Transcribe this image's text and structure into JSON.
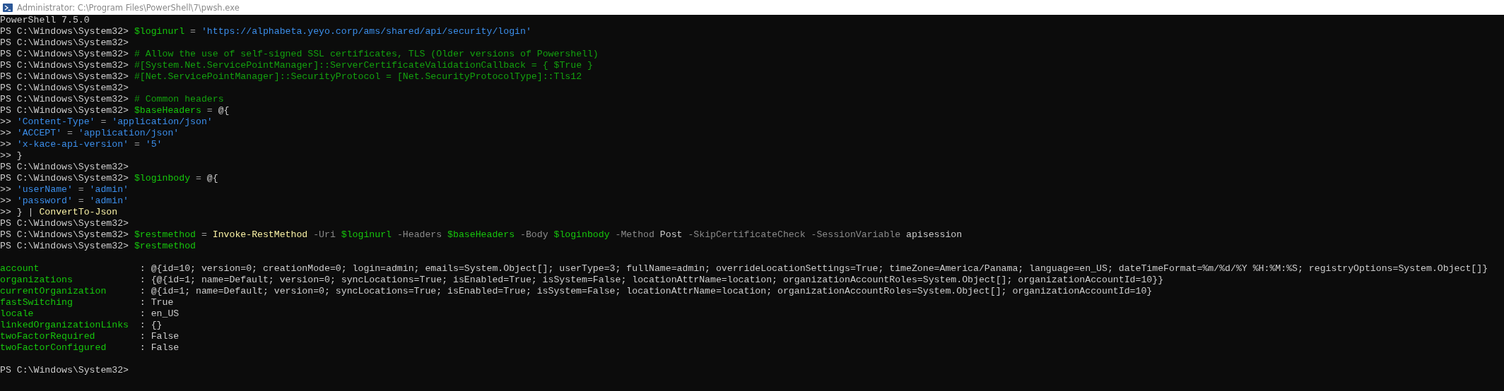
{
  "window": {
    "title": "Administrator: C:\\Program Files\\PowerShell\\7\\pwsh.exe"
  },
  "lines": [
    {
      "kind": "text",
      "segments": [
        {
          "kind": "plain",
          "text": "PowerShell 7.5.0"
        }
      ]
    },
    {
      "kind": "text",
      "segments": [
        {
          "kind": "prompt",
          "text": "PS C:\\Windows\\System32>"
        },
        {
          "kind": "variable",
          "text": "$loginurl"
        },
        {
          "kind": "operator",
          "text": "="
        },
        {
          "kind": "string",
          "text": "'https://alphabeta.yeyo.corp/ams/shared/api/security/login'"
        }
      ]
    },
    {
      "kind": "text",
      "segments": [
        {
          "kind": "prompt",
          "text": "PS C:\\Windows\\System32>"
        }
      ]
    },
    {
      "kind": "text",
      "segments": [
        {
          "kind": "prompt",
          "text": "PS C:\\Windows\\System32>"
        },
        {
          "kind": "comment",
          "text": "# Allow the use of self-signed SSL certificates, TLS (Older versions of Powershell)"
        }
      ]
    },
    {
      "kind": "text",
      "segments": [
        {
          "kind": "prompt",
          "text": "PS C:\\Windows\\System32>"
        },
        {
          "kind": "comment",
          "text": "#[System.Net.ServicePointManager]::ServerCertificateValidationCallback = { $True }"
        }
      ]
    },
    {
      "kind": "text",
      "segments": [
        {
          "kind": "prompt",
          "text": "PS C:\\Windows\\System32>"
        },
        {
          "kind": "comment",
          "text": "#[Net.ServicePointManager]::SecurityProtocol = [Net.SecurityProtocolType]::Tls12"
        }
      ]
    },
    {
      "kind": "text",
      "segments": [
        {
          "kind": "prompt",
          "text": "PS C:\\Windows\\System32>"
        }
      ]
    },
    {
      "kind": "text",
      "segments": [
        {
          "kind": "prompt",
          "text": "PS C:\\Windows\\System32>"
        },
        {
          "kind": "comment",
          "text": "# Common headers"
        }
      ]
    },
    {
      "kind": "text",
      "segments": [
        {
          "kind": "prompt",
          "text": "PS C:\\Windows\\System32>"
        },
        {
          "kind": "variable",
          "text": "$baseHeaders"
        },
        {
          "kind": "operator",
          "text": "="
        },
        {
          "kind": "plain",
          "text": "@{"
        }
      ]
    },
    {
      "kind": "text",
      "segments": [
        {
          "kind": "prompt",
          "text": ">>"
        },
        {
          "kind": "string",
          "text": "'Content-Type'"
        },
        {
          "kind": "operator",
          "text": "="
        },
        {
          "kind": "string",
          "text": "'application/json'"
        }
      ]
    },
    {
      "kind": "text",
      "segments": [
        {
          "kind": "prompt",
          "text": ">>"
        },
        {
          "kind": "string",
          "text": "'ACCEPT'"
        },
        {
          "kind": "operator",
          "text": "="
        },
        {
          "kind": "string",
          "text": "'application/json'"
        }
      ]
    },
    {
      "kind": "text",
      "segments": [
        {
          "kind": "prompt",
          "text": ">>"
        },
        {
          "kind": "string",
          "text": "'x-kace-api-version'"
        },
        {
          "kind": "operator",
          "text": "="
        },
        {
          "kind": "string",
          "text": "'5'"
        }
      ]
    },
    {
      "kind": "text",
      "segments": [
        {
          "kind": "prompt",
          "text": ">>"
        },
        {
          "kind": "plain",
          "text": "}"
        }
      ]
    },
    {
      "kind": "text",
      "segments": [
        {
          "kind": "prompt",
          "text": "PS C:\\Windows\\System32>"
        }
      ]
    },
    {
      "kind": "text",
      "segments": [
        {
          "kind": "prompt",
          "text": "PS C:\\Windows\\System32>"
        },
        {
          "kind": "variable",
          "text": "$loginbody"
        },
        {
          "kind": "operator",
          "text": "="
        },
        {
          "kind": "plain",
          "text": "@{"
        }
      ]
    },
    {
      "kind": "text",
      "segments": [
        {
          "kind": "prompt",
          "text": ">>"
        },
        {
          "kind": "string",
          "text": "'userName'"
        },
        {
          "kind": "operator",
          "text": "="
        },
        {
          "kind": "string",
          "text": "'admin'"
        }
      ]
    },
    {
      "kind": "text",
      "segments": [
        {
          "kind": "prompt",
          "text": ">>"
        },
        {
          "kind": "string",
          "text": "'password'"
        },
        {
          "kind": "operator",
          "text": "="
        },
        {
          "kind": "string",
          "text": "'admin'"
        }
      ]
    },
    {
      "kind": "text",
      "segments": [
        {
          "kind": "prompt",
          "text": ">>"
        },
        {
          "kind": "plain",
          "text": "}"
        },
        {
          "kind": "plain",
          "text": "|"
        },
        {
          "kind": "command",
          "text": "ConvertTo-Json"
        }
      ]
    },
    {
      "kind": "text",
      "segments": [
        {
          "kind": "prompt",
          "text": "PS C:\\Windows\\System32>"
        }
      ]
    },
    {
      "kind": "text",
      "segments": [
        {
          "kind": "prompt",
          "text": "PS C:\\Windows\\System32>"
        },
        {
          "kind": "variable",
          "text": "$restmethod"
        },
        {
          "kind": "operator",
          "text": "="
        },
        {
          "kind": "command",
          "text": "Invoke-RestMethod"
        },
        {
          "kind": "parameter",
          "text": "-Uri"
        },
        {
          "kind": "variable",
          "text": "$loginurl"
        },
        {
          "kind": "parameter",
          "text": "-Headers"
        },
        {
          "kind": "variable",
          "text": "$baseHeaders"
        },
        {
          "kind": "parameter",
          "text": "-Body"
        },
        {
          "kind": "variable",
          "text": "$loginbody"
        },
        {
          "kind": "parameter",
          "text": "-Method"
        },
        {
          "kind": "plain",
          "text": "Post"
        },
        {
          "kind": "parameter",
          "text": "-SkipCertificateCheck"
        },
        {
          "kind": "parameter",
          "text": "-SessionVariable"
        },
        {
          "kind": "plain",
          "text": "apisession"
        }
      ]
    },
    {
      "kind": "text",
      "segments": [
        {
          "kind": "prompt",
          "text": "PS C:\\Windows\\System32>"
        },
        {
          "kind": "variable",
          "text": "$restmethod"
        }
      ]
    },
    {
      "kind": "blank"
    },
    {
      "kind": "property",
      "name": "account",
      "separator": ":",
      "value": "@{id=10; version=0; creationMode=0; login=admin; emails=System.Object[]; userType=3; fullName=admin; overrideLocationSettings=True; timeZone=America/Panama; language=en_US; dateTimeFormat=%m/%d/%Y %H:%M:%S; registryOptions=System.Object[]}"
    },
    {
      "kind": "property",
      "name": "organizations",
      "separator": ":",
      "value": "{@{id=1; name=Default; version=0; syncLocations=True; isEnabled=True; isSystem=False; locationAttrName=location; organizationAccountRoles=System.Object[]; organizationAccountId=10}}"
    },
    {
      "kind": "property",
      "name": "currentOrganization",
      "separator": ":",
      "value": "@{id=1; name=Default; version=0; syncLocations=True; isEnabled=True; isSystem=False; locationAttrName=location; organizationAccountRoles=System.Object[]; organizationAccountId=10}"
    },
    {
      "kind": "property",
      "name": "fastSwitching",
      "separator": ":",
      "value": "True"
    },
    {
      "kind": "property",
      "name": "locale",
      "separator": ":",
      "value": "en_US"
    },
    {
      "kind": "property",
      "name": "linkedOrganizationLinks",
      "separator": ":",
      "value": "{}"
    },
    {
      "kind": "property",
      "name": "twoFactorRequired",
      "separator": ":",
      "value": "False"
    },
    {
      "kind": "property",
      "name": "twoFactorConfigured",
      "separator": ":",
      "value": "False"
    },
    {
      "kind": "blank"
    },
    {
      "kind": "text",
      "segments": [
        {
          "kind": "prompt",
          "text": "PS C:\\Windows\\System32>"
        }
      ]
    }
  ]
}
